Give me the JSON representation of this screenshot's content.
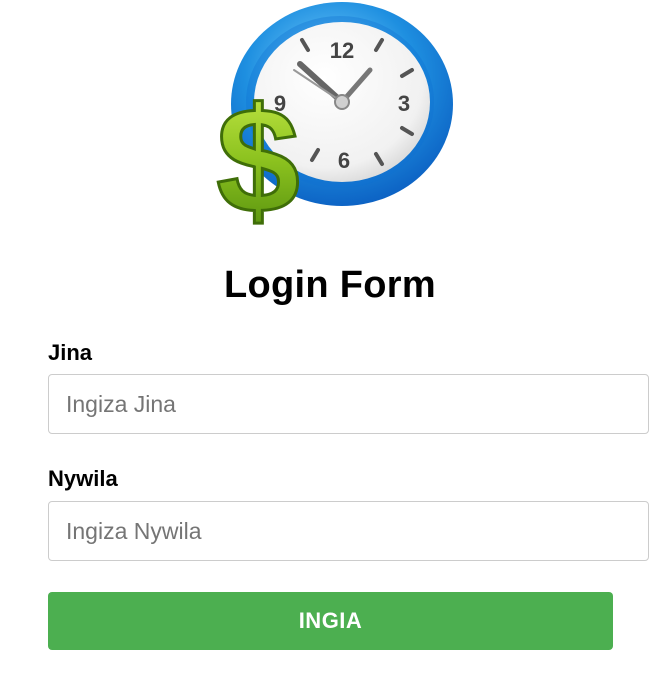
{
  "logo": {
    "icon": "clock-dollar-icon",
    "clock_numbers": [
      "12",
      "3",
      "6",
      "9"
    ],
    "colors": {
      "clock_rim": "#1e8fe0",
      "dollar_green": "#8cc21f",
      "clock_face": "#ffffff"
    }
  },
  "form": {
    "title": "Login Form",
    "username_label": "Jina",
    "username_placeholder": "Ingiza Jina",
    "password_label": "Nywila",
    "password_placeholder": "Ingiza Nywila",
    "submit_label": "INGIA"
  },
  "colors": {
    "button_bg": "#4caf50",
    "button_text": "#ffffff",
    "input_border": "#cccccc"
  }
}
